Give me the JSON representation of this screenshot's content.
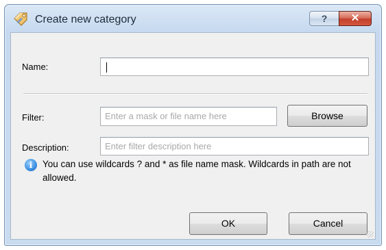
{
  "dialog": {
    "title": "Create new category",
    "help_glyph": "?",
    "close_glyph": "✕",
    "icon": "tag-icon"
  },
  "form": {
    "name_label": "Name:",
    "name_value": "",
    "filter_label": "Filter:",
    "filter_placeholder": "Enter a mask or file name here",
    "browse_label": "Browse",
    "description_label": "Description:",
    "description_placeholder": "Enter filter description here"
  },
  "info": {
    "icon": "info-icon",
    "text": "You can use wildcards ? and * as file name mask. Wildcards in path are not allowed."
  },
  "buttons": {
    "ok_label": "OK",
    "cancel_label": "Cancel"
  },
  "colors": {
    "title_bg": "#c6d9ef",
    "client_bg": "#f0f0f0",
    "close_button": "#c2412c",
    "info_icon": "#3a8fe0"
  }
}
